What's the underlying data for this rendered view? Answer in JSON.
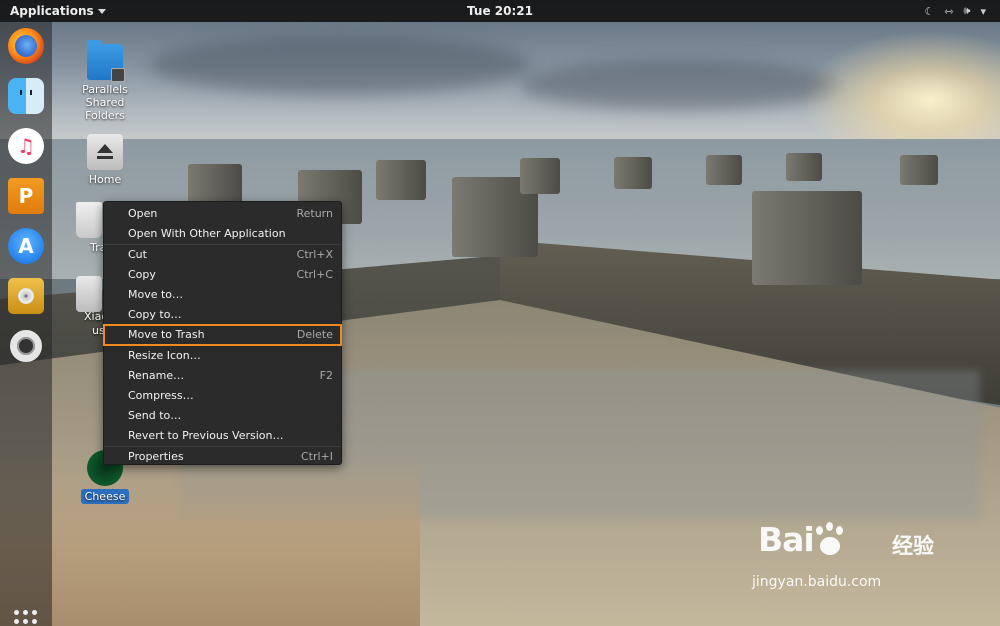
{
  "top_bar": {
    "applications_label": "Applications",
    "clock": "Tue 20:21"
  },
  "dock": {
    "items": [
      {
        "name": "Firefox",
        "icon": "firefox-icon"
      },
      {
        "name": "Finder",
        "icon": "finder-icon"
      },
      {
        "name": "iTunes",
        "icon": "itunes-icon"
      },
      {
        "name": "Parallels",
        "icon": "parallels-icon"
      },
      {
        "name": "App Store",
        "icon": "app-store-icon"
      },
      {
        "name": "Installer",
        "icon": "installer-icon"
      },
      {
        "name": "Help",
        "icon": "lifebuoy-icon"
      }
    ]
  },
  "desktop": {
    "icons": [
      {
        "label": "Parallels Shared Folders",
        "icon": "shared-folder-icon"
      },
      {
        "label": "Home",
        "icon": "home-icon"
      },
      {
        "label": "Tra",
        "icon": "trash-icon"
      },
      {
        "label": "Xiao",
        "icon": "user-folder-icon"
      },
      {
        "label": "us",
        "icon": "user-folder-icon"
      },
      {
        "label": "Cheese",
        "icon": "cheese-icon"
      }
    ]
  },
  "context_menu": {
    "sections": [
      [
        {
          "label": "Open",
          "shortcut": "Return"
        },
        {
          "label": "Open With Other Application",
          "shortcut": ""
        }
      ],
      [
        {
          "label": "Cut",
          "shortcut": "Ctrl+X"
        },
        {
          "label": "Copy",
          "shortcut": "Ctrl+C"
        },
        {
          "label": "Move to…",
          "shortcut": ""
        },
        {
          "label": "Copy to…",
          "shortcut": ""
        },
        {
          "label": "Move to Trash",
          "shortcut": "Delete",
          "highlighted": true
        }
      ],
      [
        {
          "label": "Resize Icon…",
          "shortcut": ""
        },
        {
          "label": "Rename…",
          "shortcut": "F2"
        },
        {
          "label": "Compress…",
          "shortcut": ""
        },
        {
          "label": "Send to…",
          "shortcut": ""
        },
        {
          "label": "Revert to Previous Version…",
          "shortcut": ""
        }
      ],
      [
        {
          "label": "Properties",
          "shortcut": "Ctrl+I"
        }
      ]
    ],
    "highlight_color": "#f08a24"
  },
  "watermark": {
    "brand_left": "Bai",
    "brand_right": "经验",
    "url": "jingyan.baidu.com"
  },
  "colors": {
    "topbar": "#141414",
    "menu_bg": "#2b2b2b",
    "selection_blue": "#2d6fbf"
  }
}
